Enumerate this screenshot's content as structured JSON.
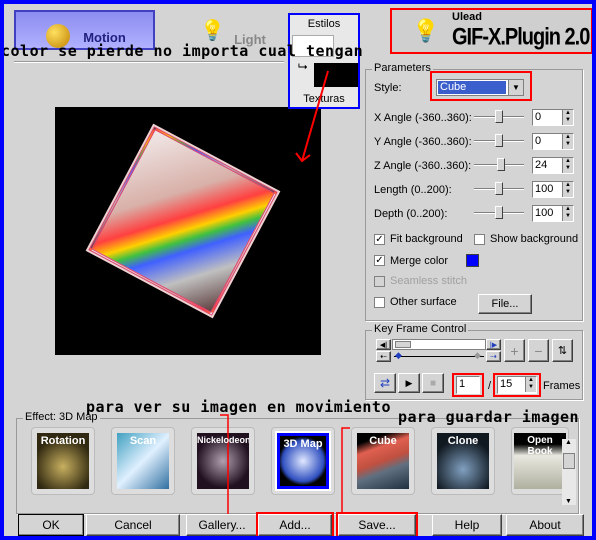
{
  "tabs": [
    {
      "label": "Motion",
      "active": true
    },
    {
      "label": "Light",
      "active": false
    }
  ],
  "logo": {
    "brand": "Ulead",
    "product": "GIF-X.Plugin 2.0"
  },
  "overlay_box": {
    "top_label": "Estilos",
    "bottom_label": "Texturas"
  },
  "annotations": {
    "color_note": "color se pierde no importa cual tengan",
    "add_note": "para ver su imagen en movimiento",
    "save_note": "para guardar imagen"
  },
  "parameters": {
    "title": "Parameters",
    "style_label": "Style:",
    "style_value": "Cube",
    "sliders": [
      {
        "label": "X Angle (-360..360):",
        "value": "0",
        "fraction": 0.5
      },
      {
        "label": "Y Angle (-360..360):",
        "value": "0",
        "fraction": 0.5
      },
      {
        "label": "Z Angle (-360..360):",
        "value": "24",
        "fraction": 0.53
      },
      {
        "label": "Length (0..200):",
        "value": "100",
        "fraction": 0.5
      },
      {
        "label": "Depth (0..200):",
        "value": "100",
        "fraction": 0.5
      }
    ],
    "fit_background": {
      "label": "Fit background",
      "checked": true
    },
    "show_background": {
      "label": "Show background",
      "checked": false
    },
    "merge_color": {
      "label": "Merge color",
      "checked": true,
      "color": "#0000ff"
    },
    "seamless_stitch": {
      "label": "Seamless stitch",
      "checked": false,
      "disabled": true
    },
    "other_surface": {
      "label": "Other surface",
      "checked": false
    },
    "file_button": "File..."
  },
  "keyframe": {
    "title": "Key Frame Control",
    "current_frame": "1",
    "separator": "/",
    "total_frames": "15",
    "frames_label": "Frames"
  },
  "effects": {
    "title": "Effect: 3D Map",
    "items": [
      {
        "label": "Rotation",
        "selected": false
      },
      {
        "label": "Scan",
        "selected": false
      },
      {
        "label": "Nickelodeon",
        "selected": false
      },
      {
        "label": "3D Map",
        "selected": true
      },
      {
        "label": "Cube",
        "selected": false
      },
      {
        "label": "Clone",
        "selected": false
      },
      {
        "label": "Open Book",
        "selected": false
      }
    ]
  },
  "buttons": {
    "ok": "OK",
    "cancel": "Cancel",
    "gallery": "Gallery...",
    "add": "Add...",
    "save": "Save...",
    "help": "Help",
    "about": "About"
  },
  "colors": {
    "frame": "#0000ff",
    "highlight": "#ff0000",
    "selection": "#3a5fcd"
  }
}
